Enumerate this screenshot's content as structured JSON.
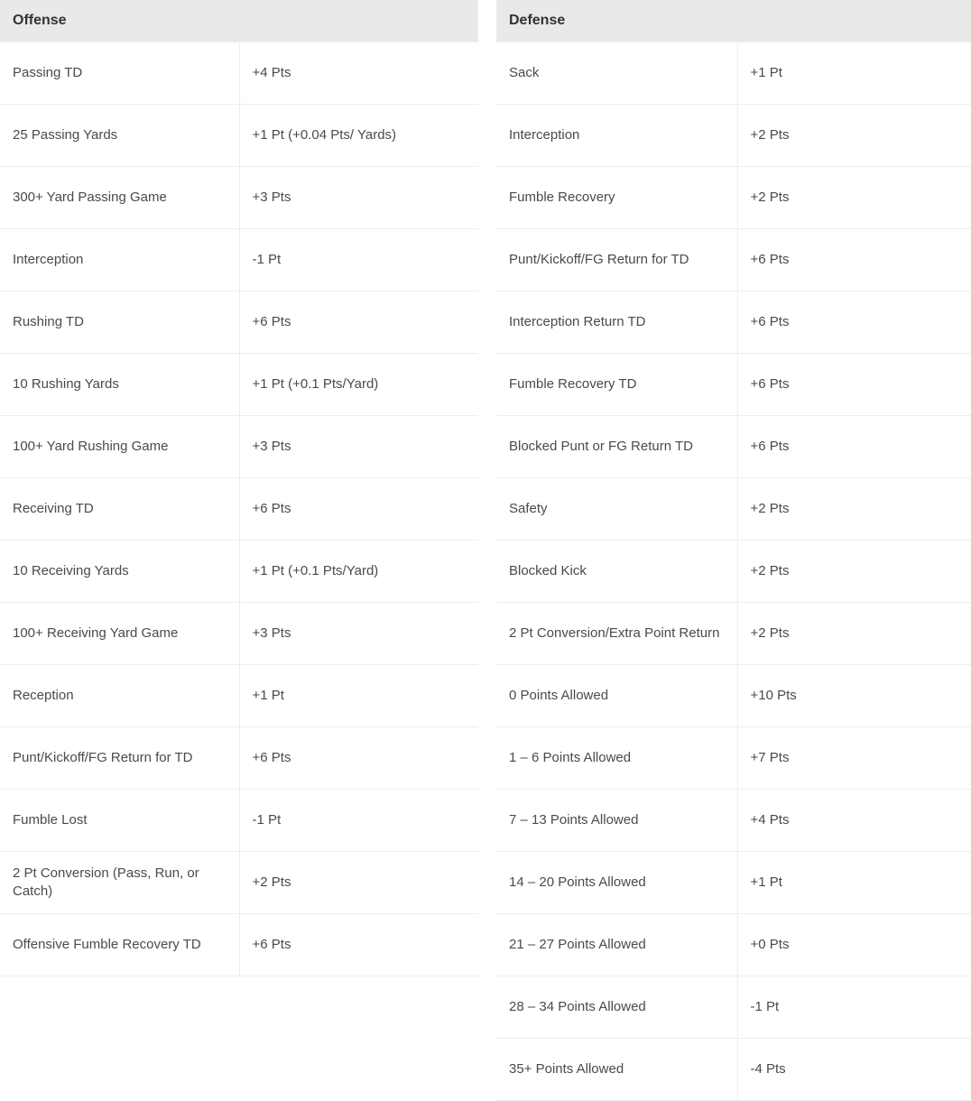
{
  "offense": {
    "title": "Offense",
    "rows": [
      {
        "label": "Passing TD",
        "value": "+4 Pts"
      },
      {
        "label": "25 Passing Yards",
        "value": "+1 Pt (+0.04 Pts/ Yards)"
      },
      {
        "label": "300+ Yard Passing Game",
        "value": "+3 Pts"
      },
      {
        "label": "Interception",
        "value": "-1 Pt"
      },
      {
        "label": "Rushing TD",
        "value": "+6 Pts"
      },
      {
        "label": "10 Rushing Yards",
        "value": "+1 Pt (+0.1 Pts/Yard)"
      },
      {
        "label": "100+ Yard Rushing Game",
        "value": "+3 Pts"
      },
      {
        "label": "Receiving TD",
        "value": "+6 Pts"
      },
      {
        "label": "10 Receiving Yards",
        "value": "+1 Pt (+0.1 Pts/Yard)"
      },
      {
        "label": "100+ Receiving Yard Game",
        "value": "+3 Pts"
      },
      {
        "label": "Reception",
        "value": "+1 Pt"
      },
      {
        "label": "Punt/Kickoff/FG Return for TD",
        "value": "+6 Pts"
      },
      {
        "label": "Fumble Lost",
        "value": "-1 Pt"
      },
      {
        "label": "2 Pt Conversion (Pass, Run, or Catch)",
        "value": "+2 Pts"
      },
      {
        "label": "Offensive Fumble Recovery TD",
        "value": "+6 Pts"
      }
    ]
  },
  "defense": {
    "title": "Defense",
    "rows": [
      {
        "label": "Sack",
        "value": "+1 Pt"
      },
      {
        "label": "Interception",
        "value": "+2 Pts"
      },
      {
        "label": "Fumble Recovery",
        "value": "+2 Pts"
      },
      {
        "label": "Punt/Kickoff/FG Return for TD",
        "value": "+6 Pts"
      },
      {
        "label": "Interception Return TD",
        "value": "+6 Pts"
      },
      {
        "label": "Fumble Recovery TD",
        "value": "+6 Pts"
      },
      {
        "label": "Blocked Punt or FG Return TD",
        "value": "+6 Pts"
      },
      {
        "label": "Safety",
        "value": "+2 Pts"
      },
      {
        "label": "Blocked Kick",
        "value": "+2 Pts"
      },
      {
        "label": "2 Pt Conversion/Extra Point Return",
        "value": "+2 Pts"
      },
      {
        "label": "0 Points Allowed",
        "value": "+10 Pts"
      },
      {
        "label": "1 – 6 Points Allowed",
        "value": "+7 Pts"
      },
      {
        "label": "7 – 13 Points Allowed",
        "value": "+4 Pts"
      },
      {
        "label": "14 – 20 Points Allowed",
        "value": "+1 Pt"
      },
      {
        "label": "21 – 27 Points Allowed",
        "value": "+0 Pts"
      },
      {
        "label": "28 – 34 Points Allowed",
        "value": "-1 Pt"
      },
      {
        "label": "35+ Points Allowed",
        "value": "-4 Pts"
      }
    ]
  },
  "colors": {
    "header_background": "#e9e9e9",
    "header_text": "#333333",
    "body_text": "#4a4a4a",
    "border": "#eceded",
    "page_background": "#ffffff"
  }
}
